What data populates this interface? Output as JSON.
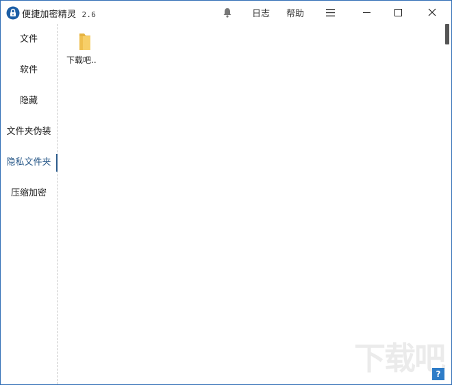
{
  "window": {
    "title": "便捷加密精灵",
    "version": "2.6"
  },
  "titlebar": {
    "log_label": "日志",
    "help_label": "帮助",
    "minimize_glyph": "—",
    "maximize_glyph": "☐",
    "close_glyph": "✕",
    "menu_glyph": "≡"
  },
  "sidebar": {
    "items": [
      {
        "label": "文件"
      },
      {
        "label": "软件"
      },
      {
        "label": "隐藏"
      },
      {
        "label": "文件夹伪装"
      },
      {
        "label": "隐私文件夹",
        "active": true
      },
      {
        "label": "压缩加密"
      }
    ]
  },
  "main": {
    "files": [
      {
        "name": "下载吧.."
      }
    ]
  },
  "watermark": {
    "text": "下载吧"
  },
  "help_badge": {
    "text": "?"
  },
  "colors": {
    "accent": "#2a5a8a",
    "border": "#2f6db5",
    "folder": "#f5c85c"
  }
}
